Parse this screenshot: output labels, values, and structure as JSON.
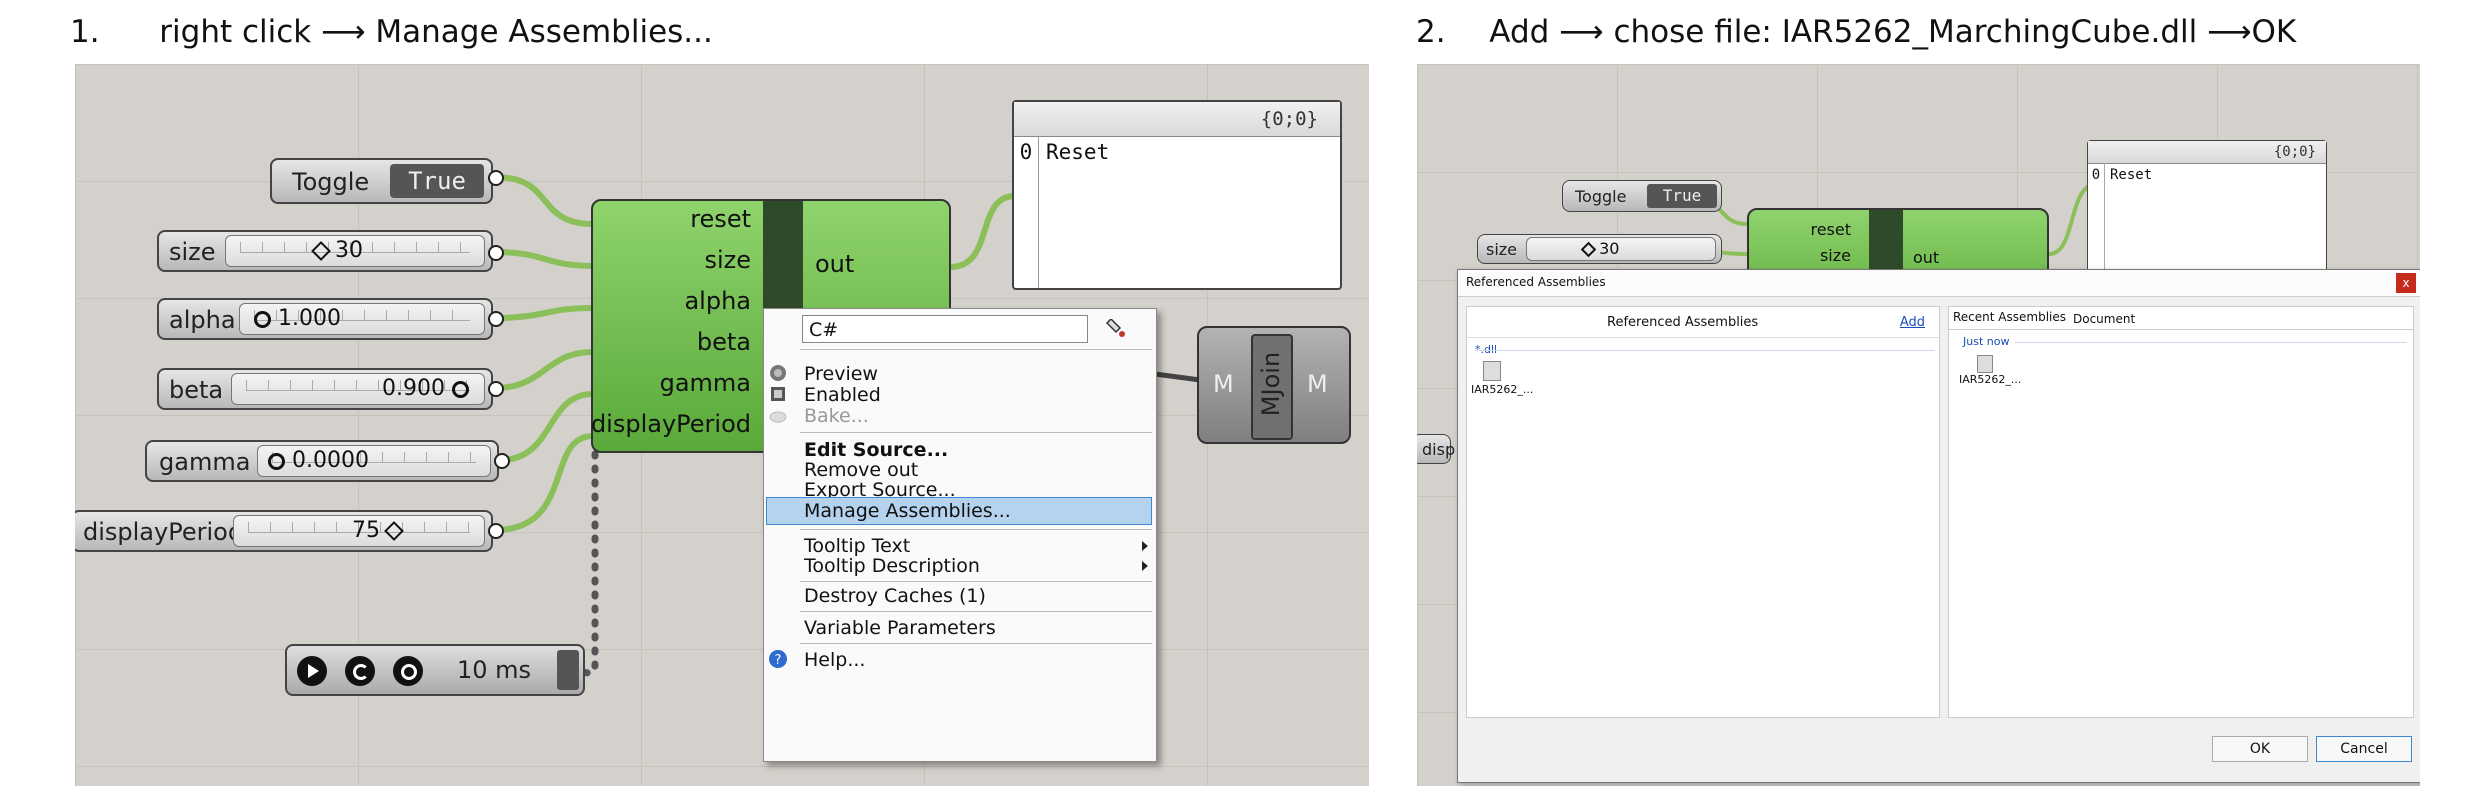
{
  "steps": [
    {
      "number": "1.",
      "text": "right click  ⟶ Manage Assemblies..."
    },
    {
      "number": "2.",
      "text": "Add ⟶ chose file: IAR5262_MarchingCube.dll ⟶OK"
    }
  ],
  "colors": {
    "canvas": "#d4d0cb",
    "component_green": "#6bbf49",
    "wire_green": "#8bbf5a",
    "menu_highlight": "#b5d3ee",
    "link_blue": "#1a4fb5"
  },
  "panel1": {
    "toggle": {
      "label": "Toggle",
      "value": "True"
    },
    "sliders": [
      {
        "name": "size",
        "value": "30"
      },
      {
        "name": "alpha",
        "value": "1.000"
      },
      {
        "name": "beta",
        "value": "0.900"
      },
      {
        "name": "gamma",
        "value": "0.0000"
      },
      {
        "name": "displayPeriod",
        "value": "75"
      }
    ],
    "component": {
      "inputs": [
        "reset",
        "size",
        "alpha",
        "beta",
        "gamma",
        "displayPeriod"
      ],
      "output": "out"
    },
    "panel": {
      "header": "{0;0}",
      "index": "0",
      "text": "Reset"
    },
    "mjoin": {
      "left": "M",
      "center": "MJoin",
      "right": "M"
    },
    "timer": {
      "value": "10 ms"
    },
    "context_menu": {
      "search_value": "C#",
      "icons": [
        "preview-icon",
        "enabled-icon",
        "bake-icon",
        "paint-icon",
        "help-icon"
      ],
      "items": [
        {
          "label": "Preview"
        },
        {
          "label": "Enabled"
        },
        {
          "label": "Bake..."
        },
        {
          "label": "Edit Source..."
        },
        {
          "label": "Remove out"
        },
        {
          "label": "Export Source..."
        },
        {
          "label": "Manage Assemblies..."
        },
        {
          "label": "Tooltip Text"
        },
        {
          "label": "Tooltip Description"
        },
        {
          "label": "Destroy Caches (1)"
        },
        {
          "label": "Variable Parameters"
        },
        {
          "label": "Help..."
        }
      ]
    }
  },
  "panel2": {
    "toggle": {
      "label": "Toggle",
      "value": "True"
    },
    "slider": {
      "name": "size",
      "value": "30"
    },
    "component": {
      "inputs": [
        "reset",
        "size"
      ],
      "output": "out"
    },
    "panel": {
      "header": "{0;0}",
      "index": "0",
      "text": "Reset"
    },
    "partial_label": "disp",
    "dialog": {
      "title": "Referenced Assemblies",
      "close": "x",
      "left_header": "Referenced Assemblies",
      "add_link": "Add",
      "left_group": "*.dll",
      "left_file": "IAR5262_...",
      "tabs": [
        "Recent Assemblies",
        "Document"
      ],
      "right_group": "Just now",
      "right_file": "IAR5262_...",
      "ok": "OK",
      "cancel": "Cancel"
    }
  }
}
